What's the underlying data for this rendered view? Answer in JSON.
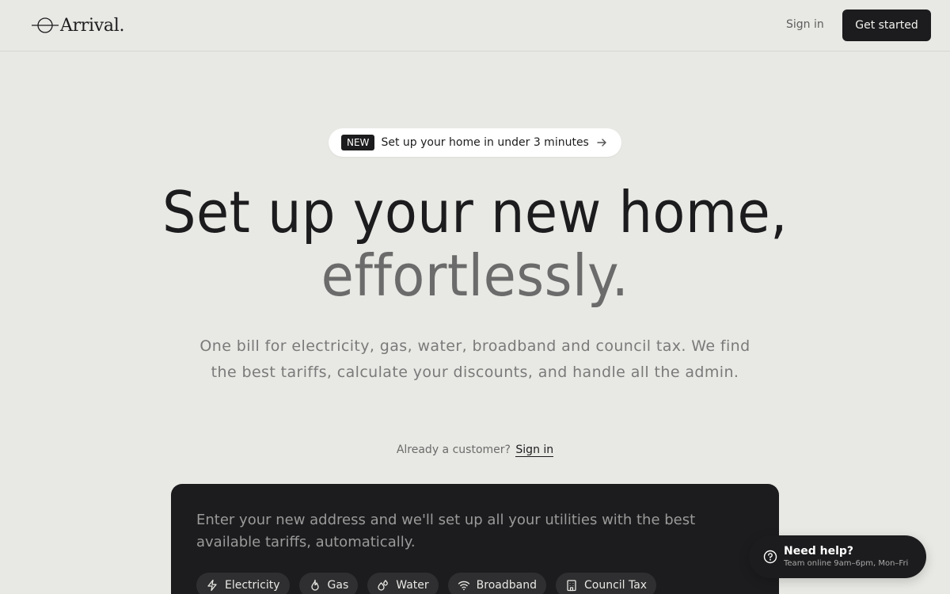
{
  "header": {
    "logo_text": "Arrival.",
    "sign_in": "Sign in",
    "get_started": "Get started"
  },
  "announcement": {
    "badge": "NEW",
    "text": "Set up your home in under 3 minutes"
  },
  "hero": {
    "line1": "Set up your new home,",
    "line2": "effortlessly.",
    "subtitle": "One bill for electricity, gas, water, broadband and council tax. We find the best tariffs, calculate your discounts, and handle all the admin.",
    "already_customer": "Already a customer?",
    "sign_in_link": "Sign in"
  },
  "card": {
    "text": "Enter your new address and we'll set up all your utilities with the best available tariffs, automatically.",
    "chips": [
      {
        "label": "Electricity",
        "icon": "lightning-icon"
      },
      {
        "label": "Gas",
        "icon": "flame-icon"
      },
      {
        "label": "Water",
        "icon": "droplets-icon"
      },
      {
        "label": "Broadband",
        "icon": "wifi-icon"
      },
      {
        "label": "Council Tax",
        "icon": "building-icon"
      }
    ]
  },
  "help": {
    "title": "Need help?",
    "subtitle": "Team online 9am–6pm, Mon–Fri"
  }
}
